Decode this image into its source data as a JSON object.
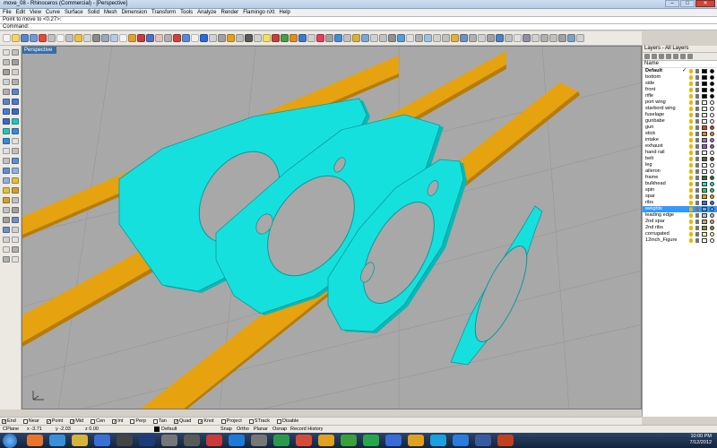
{
  "window": {
    "title": "move_08 - Rhinoceros (Commercial) - [Perspective]",
    "buttons": [
      "–",
      "□",
      "✕"
    ]
  },
  "menu": [
    "File",
    "Edit",
    "View",
    "Curve",
    "Surface",
    "Solid",
    "Mesh",
    "Dimension",
    "Transform",
    "Tools",
    "Analyze",
    "Render",
    "Flamingo nXt",
    "Help"
  ],
  "command_history": "Point to move to <0.27>:",
  "command_prompt": "Command:",
  "viewport": {
    "label": "Perspective",
    "colors": {
      "background": "#a8a8a8",
      "frame": "#16e0de",
      "frame_edge": "#0ab8b6",
      "spar": "#e6a20f",
      "spar_edge": "#b87c05",
      "grid": "#8e8e8e"
    }
  },
  "layers_panel": {
    "title": "Layers - All Layers",
    "column_header": "Name",
    "layers": [
      {
        "name": "Default",
        "current": true,
        "color": "#000000"
      },
      {
        "name": "bottom",
        "color": "#000000"
      },
      {
        "name": "side",
        "color": "#000000"
      },
      {
        "name": "front",
        "color": "#000000"
      },
      {
        "name": "rifle",
        "color": "#000000"
      },
      {
        "name": "port wing",
        "color": "#ffffff"
      },
      {
        "name": "starbord wing",
        "color": "#ffffff"
      },
      {
        "name": "fuselage",
        "color": "#ffffff"
      },
      {
        "name": "gunbabe",
        "color": "#ffffff"
      },
      {
        "name": "gun",
        "color": "#e23b2b"
      },
      {
        "name": "stick",
        "color": "#e08a1a"
      },
      {
        "name": "intake",
        "color": "#8e7cc3"
      },
      {
        "name": "exhaust",
        "color": "#9b59b6"
      },
      {
        "name": "hand rail",
        "color": "#ffffff"
      },
      {
        "name": "belt",
        "color": "#6b5a2a"
      },
      {
        "name": "leg",
        "color": "#ffffff"
      },
      {
        "name": "aileron",
        "color": "#ffffff"
      },
      {
        "name": "frame",
        "color": "#1f7a2e"
      },
      {
        "name": "bulkhead",
        "color": "#16e0de"
      },
      {
        "name": "spin",
        "color": "#2ecc71"
      },
      {
        "name": "spar",
        "color": "#e6a20f"
      },
      {
        "name": "ribs",
        "color": "#3b6fd8"
      },
      {
        "name": "weights",
        "color": "#5dade2",
        "selected": true
      },
      {
        "name": "leading edge",
        "color": "#c0c0c0"
      },
      {
        "name": "2nd spar",
        "color": "#d4a373"
      },
      {
        "name": "2nd ribs",
        "color": "#8e8e3a"
      },
      {
        "name": "corrugated",
        "color": "#ffff99"
      },
      {
        "name": "12inch_Figure",
        "color": "#ffffff"
      }
    ]
  },
  "osnaps": [
    {
      "label": "End",
      "checked": true
    },
    {
      "label": "Near",
      "checked": false
    },
    {
      "label": "Point",
      "checked": true
    },
    {
      "label": "Mid",
      "checked": true
    },
    {
      "label": "Cen",
      "checked": false
    },
    {
      "label": "Int",
      "checked": true
    },
    {
      "label": "Perp",
      "checked": false
    },
    {
      "label": "Tan",
      "checked": false
    },
    {
      "label": "Quad",
      "checked": true
    },
    {
      "label": "Knot",
      "checked": true
    },
    {
      "label": "Project",
      "checked": false
    },
    {
      "label": "STrack",
      "checked": false
    },
    {
      "label": "Disable",
      "checked": false
    }
  ],
  "status": {
    "cplane": "CPlane",
    "x": "x -3.71",
    "y": "y -2.03",
    "z": "z 0.00",
    "layer": "Default",
    "modes": [
      "Snap",
      "Ortho",
      "Planar",
      "Osnap",
      "Record History"
    ]
  },
  "taskbar": {
    "time": "10:00 PM",
    "date": "7/12/2012"
  }
}
